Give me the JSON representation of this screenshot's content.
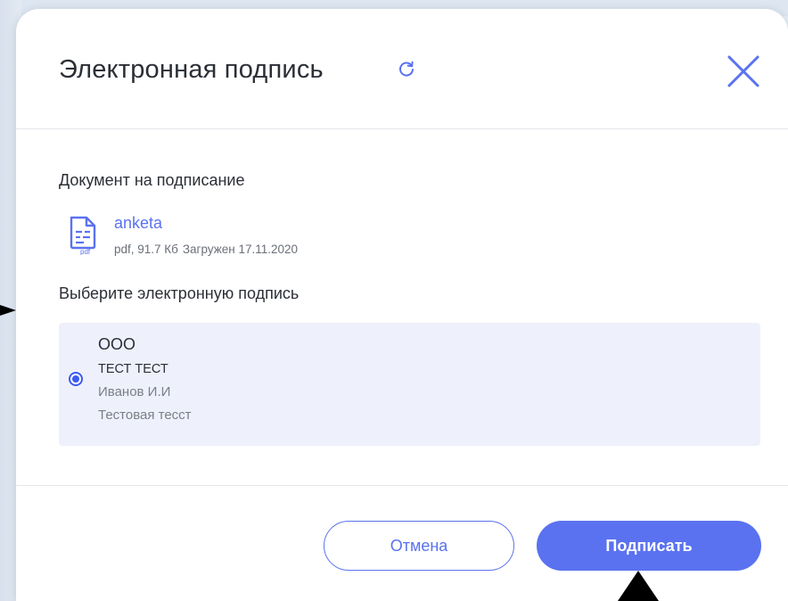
{
  "dialog": {
    "title": "Электронная подпись",
    "refresh_icon": "refresh-icon",
    "close_icon": "close-icon"
  },
  "document": {
    "section_label": "Документ на подписание",
    "icon": "pdf-file-icon",
    "name": "anketa",
    "meta_type_size": "pdf, 91.7 Кб",
    "meta_uploaded": "Загружен 17.11.2020"
  },
  "signature": {
    "section_label": "Выберите электронную подпись",
    "options": [
      {
        "organization": "ООО",
        "certificate": "ТЕСТ ТЕСТ",
        "owner": "Иванов И.И",
        "org_name": "Тестовая тесст",
        "selected": true
      }
    ]
  },
  "footer": {
    "cancel_label": "Отмена",
    "sign_label": "Подписать"
  },
  "colors": {
    "accent": "#5a72f0",
    "radio": "#3d5af1",
    "card_bg": "#eef1fb"
  }
}
